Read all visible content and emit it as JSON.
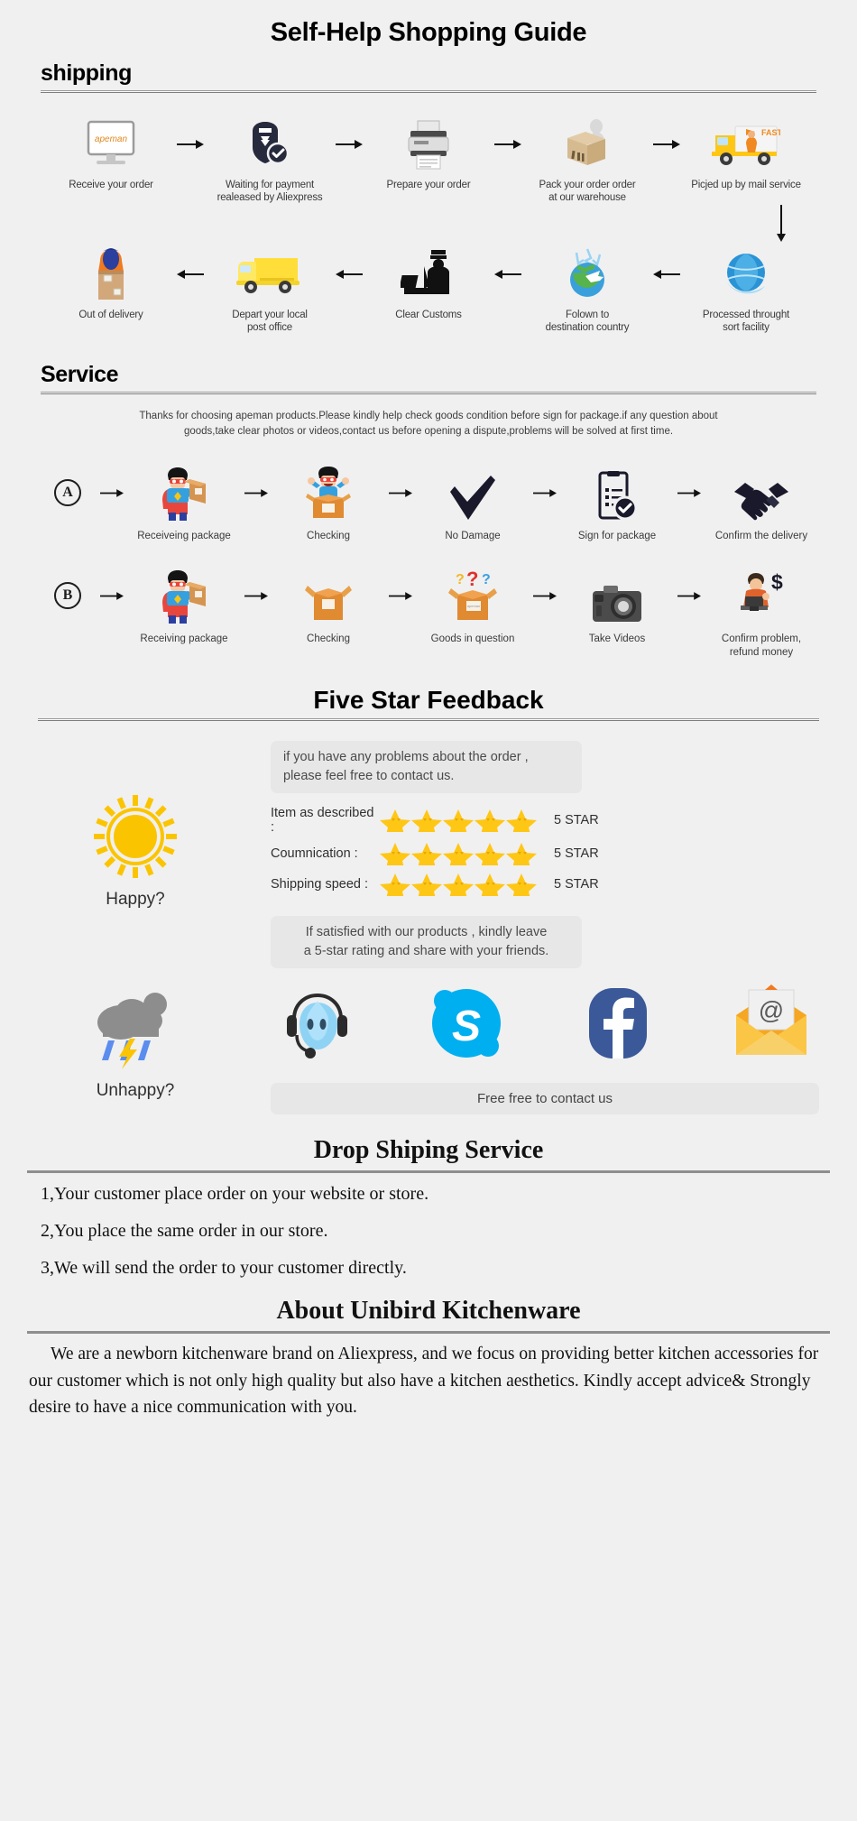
{
  "page": {
    "title": "Self-Help Shopping Guide",
    "background": "#f0f0f0"
  },
  "shipping": {
    "heading": "shipping",
    "row1": [
      {
        "label": "Receive your order",
        "icon": "monitor-apeman-icon"
      },
      {
        "label": "Waiting for payment\nrealeased by Aliexpress",
        "icon": "payment-shield-icon"
      },
      {
        "label": "Prepare your order",
        "icon": "printer-icon"
      },
      {
        "label": "Pack your order order\nat our warehouse",
        "icon": "packing-box-icon"
      },
      {
        "label": "Picjed up by mail service",
        "icon": "delivery-truck-icon"
      }
    ],
    "row2": [
      {
        "label": "Out of delivery",
        "icon": "courier-parcel-icon"
      },
      {
        "label": "Depart your local\npost office",
        "icon": "yellow-van-icon"
      },
      {
        "label": "Clear Customs",
        "icon": "customs-officer-icon"
      },
      {
        "label": "Folown to\ndestination country",
        "icon": "globe-plane-icon"
      },
      {
        "label": "Processed throught\nsort facility",
        "icon": "blue-globe-icon"
      }
    ]
  },
  "service": {
    "heading": "Service",
    "note": "Thanks for choosing apeman products.Please kindly help check goods condition before sign for package.if any question about goods,take clear photos or videos,contact us before opening a dispute,problems will be solved at first time.",
    "rowA": {
      "badge": "A",
      "steps": [
        {
          "label": "Receiveing package",
          "icon": "hero-with-parcel-icon"
        },
        {
          "label": "Checking",
          "icon": "hero-opening-box-icon"
        },
        {
          "label": "No Damage",
          "icon": "checkmark-icon"
        },
        {
          "label": "Sign for package",
          "icon": "signed-document-icon"
        },
        {
          "label": "Confirm the delivery",
          "icon": "handshake-icon"
        }
      ]
    },
    "rowB": {
      "badge": "B",
      "steps": [
        {
          "label": "Receiving package",
          "icon": "hero-with-parcel-icon"
        },
        {
          "label": "Checking",
          "icon": "open-box-icon"
        },
        {
          "label": "Goods in question",
          "icon": "box-question-marks-icon"
        },
        {
          "label": "Take Videos",
          "icon": "camera-icon"
        },
        {
          "label": "Confirm problem,\nrefund money",
          "icon": "refund-person-icon"
        }
      ]
    }
  },
  "feedback": {
    "heading": "Five Star Feedback",
    "bubble_top": "if you have any problems about the order ,\nplease feel free to contact us.",
    "happy_label": "Happy?",
    "ratings": [
      {
        "label": "Item as described :",
        "stars": 5,
        "value": "5 STAR"
      },
      {
        "label": "Coumnication :",
        "stars": 5,
        "value": "5 STAR"
      },
      {
        "label": "Shipping speed :",
        "stars": 5,
        "value": "5 STAR"
      }
    ],
    "bubble_bottom": "If satisfied with our products ,  kindly leave\na 5-star rating and share with your friends.",
    "unhappy_label": "Unhappy?",
    "social": [
      {
        "name": "live-chat-headset-icon",
        "color": "#7ec8f0"
      },
      {
        "name": "skype-icon",
        "color": "#00aff0"
      },
      {
        "name": "facebook-icon",
        "color": "#3b5998"
      },
      {
        "name": "email-icon",
        "color": "#f5c21b"
      }
    ],
    "contact_bar": "Free free to contact us",
    "star_color": "#ffc715"
  },
  "dropshipping": {
    "heading": "Drop Shiping Service",
    "lines": [
      "1,Your customer place order on your website or store.",
      "2,You place the same order in our store.",
      "3,We will send the order to your customer directly."
    ]
  },
  "about": {
    "heading": "About Unibird Kitchenware",
    "body": "We are a newborn kitchenware brand on Aliexpress, and we focus on providing better kitchen accessories for our customer which is not only high quality but also have a kitchen aesthetics. Kindly accept advice& Strongly desire to have a nice communication with you."
  }
}
